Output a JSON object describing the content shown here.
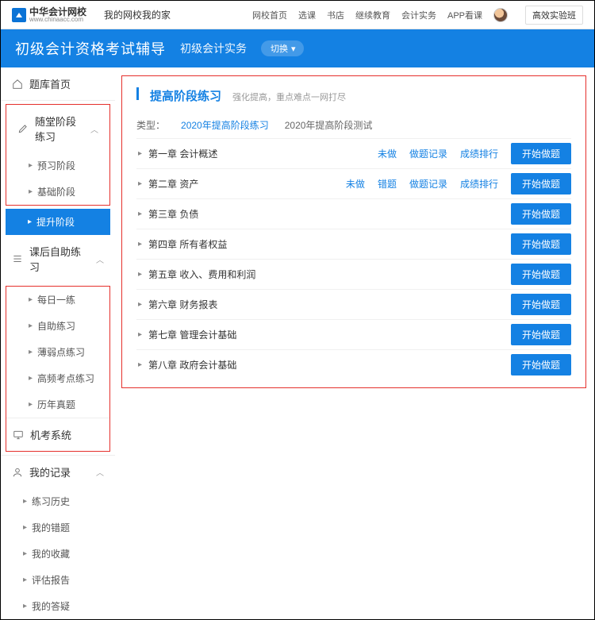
{
  "header": {
    "logo_cn": "中华会计网校",
    "logo_en": "www.chinaacc.com",
    "slogan": "我的网校我的家",
    "nav": [
      "网校首页",
      "选课",
      "书店",
      "继续教育",
      "会计实务",
      "APP看课"
    ],
    "btn": "高效实验班"
  },
  "banner": {
    "title": "初级会计资格考试辅导",
    "subject": "初级会计实务",
    "switch": "切换"
  },
  "sidebar": {
    "home": "题库首页",
    "group1": {
      "title": "随堂阶段练习",
      "items": [
        "预习阶段",
        "基础阶段",
        "提升阶段"
      ],
      "active_index": 2
    },
    "group2": {
      "title": "课后自助练习",
      "items": [
        "每日一练",
        "自助练习",
        "薄弱点练习",
        "高频考点练习",
        "历年真题"
      ]
    },
    "item_exam": "机考系统",
    "group3": {
      "title": "我的记录",
      "items": [
        "练习历史",
        "我的错题",
        "我的收藏",
        "评估报告",
        "我的答疑"
      ]
    }
  },
  "content": {
    "title": "提高阶段练习",
    "subtitle": "强化提高，重点难点一网打尽",
    "filter_label": "类型：",
    "filter_opts": [
      "2020年提高阶段练习",
      "2020年提高阶段测试"
    ],
    "btn_label": "开始做题",
    "rows": [
      {
        "chapter": "第一章 会计概述",
        "links": [
          "未做",
          "做题记录",
          "成绩排行"
        ]
      },
      {
        "chapter": "第二章 资产",
        "links": [
          "未做",
          "错题",
          "做题记录",
          "成绩排行"
        ]
      },
      {
        "chapter": "第三章 负债",
        "links": []
      },
      {
        "chapter": "第四章 所有者权益",
        "links": []
      },
      {
        "chapter": "第五章 收入、费用和利润",
        "links": []
      },
      {
        "chapter": "第六章 财务报表",
        "links": []
      },
      {
        "chapter": "第七章 管理会计基础",
        "links": []
      },
      {
        "chapter": "第八章 政府会计基础",
        "links": []
      }
    ]
  }
}
